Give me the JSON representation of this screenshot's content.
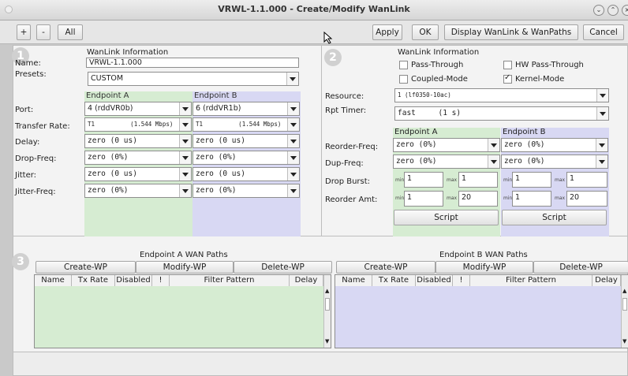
{
  "window": {
    "title": "VRWL-1.1.000 - Create/Modify WanLink"
  },
  "toolbar": {
    "plus": "+",
    "minus": "-",
    "all": "All",
    "apply": "Apply",
    "ok": "OK",
    "display": "Display WanLink & WanPaths",
    "cancel": "Cancel"
  },
  "section1": {
    "number": "1",
    "header": "WanLink Information",
    "name_label": "Name:",
    "name_value": "VRWL-1.1.000",
    "presets_label": "Presets:",
    "presets_value": "CUSTOM",
    "endpoint_a": "Endpoint A",
    "endpoint_b": "Endpoint B",
    "rows": [
      {
        "label": "Port:",
        "a": "4 (rddVR0b)",
        "b": "6 (rddVR1b)"
      },
      {
        "label": "Transfer Rate:",
        "a": "T1          (1.544 Mbps)",
        "b": "T1          (1.544 Mbps)"
      },
      {
        "label": "Delay:",
        "a": "zero (0 us)",
        "b": "zero (0 us)"
      },
      {
        "label": "Drop-Freq:",
        "a": "zero (0%)",
        "b": "zero (0%)"
      },
      {
        "label": "Jitter:",
        "a": "zero (0 us)",
        "b": "zero (0 us)"
      },
      {
        "label": "Jitter-Freq:",
        "a": "zero (0%)",
        "b": "zero (0%)"
      }
    ]
  },
  "section2": {
    "number": "2",
    "header": "WanLink Information",
    "pass_through": "Pass-Through",
    "hw_pass_through": "HW Pass-Through",
    "coupled_mode": "Coupled-Mode",
    "kernel_mode": "Kernel-Mode",
    "resource_label": "Resource:",
    "resource_value": "1 (lf0350-10ac)",
    "rpt_label": "Rpt Timer:",
    "rpt_value": "fast     (1 s)",
    "endpoint_a": "Endpoint A",
    "endpoint_b": "Endpoint B",
    "reorder_freq_label": "Reorder-Freq:",
    "reorder_a": "zero (0%)",
    "reorder_b": "zero (0%)",
    "dup_freq_label": "Dup-Freq:",
    "dup_a": "zero (0%)",
    "dup_b": "zero (0%)",
    "drop_burst_label": "Drop Burst:",
    "reorder_amt_label": "Reorder Amt:",
    "min": "min",
    "max": "max",
    "burst_a_min": "1",
    "burst_a_max": "1",
    "burst_b_min": "1",
    "burst_b_max": "1",
    "amt_a_min": "1",
    "amt_a_max": "20",
    "amt_b_min": "1",
    "amt_b_max": "20",
    "script": "Script"
  },
  "section3": {
    "number": "3",
    "a_title": "Endpoint A WAN Paths",
    "b_title": "Endpoint B WAN Paths",
    "create": "Create-WP",
    "modify": "Modify-WP",
    "delete": "Delete-WP",
    "columns": [
      "Name",
      "Tx Rate",
      "Disabled",
      "!",
      "Filter Pattern",
      "Delay"
    ]
  },
  "colors": {
    "endpoint_a_bg": "#d6ecd2",
    "endpoint_b_bg": "#d8d8f3"
  }
}
